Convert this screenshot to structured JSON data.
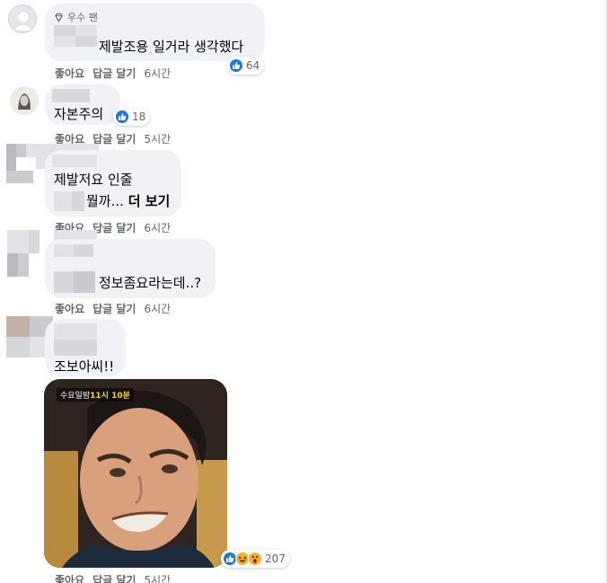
{
  "comments": [
    {
      "badge": "우수 팬",
      "text": "제발조용 일거라 생각했다",
      "reaction_count": "64",
      "actions": {
        "like": "좋아요",
        "reply": "답글 달기",
        "time": "6시간"
      }
    },
    {
      "text": "자본주의",
      "reaction_count": "18",
      "actions": {
        "like": "좋아요",
        "reply": "답글 달기",
        "time": "5시간"
      }
    },
    {
      "text_line1": "제발저요 인줄",
      "text_line2": "뭘까...",
      "see_more": "더 보기",
      "actions": {
        "like": "좋아요",
        "reply": "답글 달기",
        "time": "6시간"
      }
    },
    {
      "text": "정보좀요라는데..?",
      "actions": {
        "like": "좋아요",
        "reply": "답글 달기",
        "time": "6시간"
      }
    },
    {
      "text": "조보아씨!!",
      "image_tag_prefix": "수요일밤",
      "image_tag_time": "11시 10분",
      "reaction_count": "207",
      "actions": {
        "like": "좋아요",
        "reply": "답글 달기",
        "time": "5시간"
      }
    }
  ],
  "colors": {
    "bubble": "#f0f2f5",
    "meta_text": "#65676b",
    "like_blue": "#1877f2",
    "haha_yellow": "#f7b125"
  },
  "icons": [
    "diamond-badge-icon",
    "like-reaction-icon",
    "haha-reaction-icon",
    "wow-reaction-icon"
  ]
}
